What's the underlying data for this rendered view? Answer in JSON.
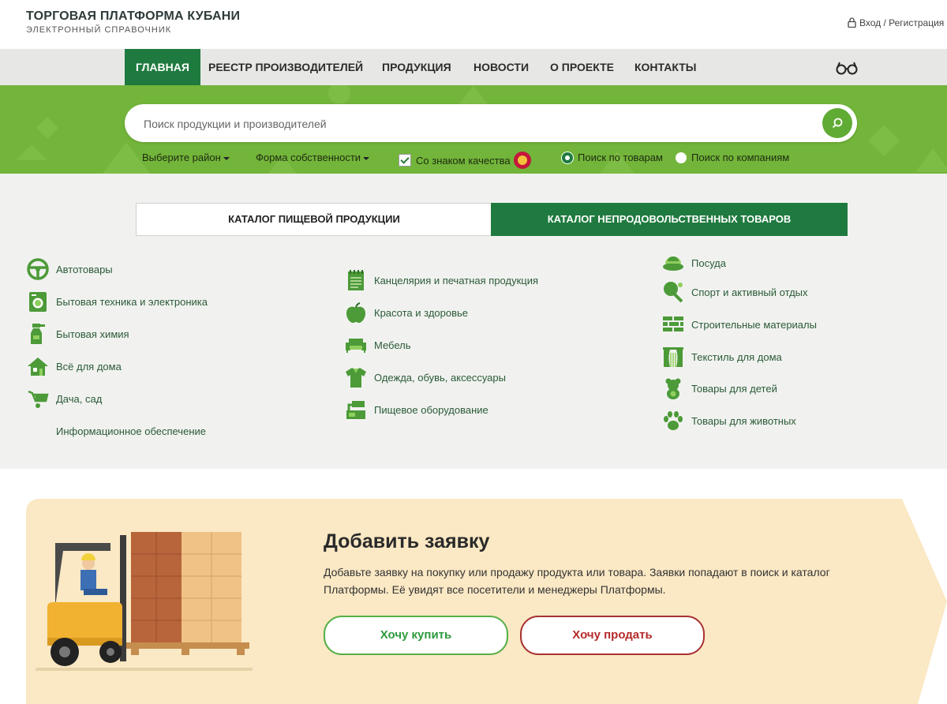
{
  "header": {
    "title": "ТОРГОВАЯ ПЛАТФОРМА КУБАНИ",
    "subtitle": "ЭЛЕКТРОННЫЙ СПРАВОЧНИК",
    "login_label": "Вход / Регистрация"
  },
  "nav": {
    "items": [
      "ГЛАВНАЯ",
      "РЕЕСТР ПРОИЗВОДИТЕЛЕЙ",
      "ПРОДУКЦИЯ",
      "НОВОСТИ",
      "О ПРОЕКТЕ",
      "КОНТАКТЫ"
    ],
    "active": "ГЛАВНАЯ",
    "accessibility_icon": "glasses-icon"
  },
  "search": {
    "placeholder": "Поиск продукции и производителей",
    "value": "",
    "filters": {
      "district": "Выберите район",
      "ownership": "Форма собственности",
      "quality_mark": "Со знаком качества",
      "quality_checked": true,
      "radio_goods": "Поиск по товарам",
      "radio_companies": "Поиск по компаниям",
      "selected_radio": "Поиск по товарам"
    }
  },
  "catalog": {
    "tab_food": "КАТАЛОГ ПИЩЕВОЙ ПРОДУКЦИИ",
    "tab_nonfood": "КАТАЛОГ НЕПРОДОВОЛЬСТВЕННЫХ ТОВАРОВ",
    "active_tab": "КАТАЛОГ НЕПРОДОВОЛЬСТВЕННЫХ ТОВАРОВ",
    "col1": [
      "Автотовары",
      "Бытовая техника и электроника",
      "Бытовая химия",
      "Всё для дома",
      "Дача, сад",
      "Информационное обеспечение"
    ],
    "col2": [
      "Канцелярия и печатная продукция",
      "Красота и здоровье",
      "Мебель",
      "Одежда, обувь, аксессуары",
      "Пищевое оборудование"
    ],
    "col3": [
      "Посуда",
      "Спорт и активный отдых",
      "Строительные материалы",
      "Текстиль для дома",
      "Товары для детей",
      "Товары для животных"
    ]
  },
  "request": {
    "title": "Добавить заявку",
    "text": "Добавьте заявку на покупку или продажу продукта или товара. Заявки попадают в поиск и каталог Платформы. Её увидят все посетители и менеджеры Платформы.",
    "buy_label": "Хочу купить",
    "sell_label": "Хочу продать"
  },
  "colors": {
    "brand_green": "#1f7a3f",
    "hero_green": "#72b53a",
    "banner_bg": "#fbe8c4",
    "sell_red": "#b52a2a"
  }
}
